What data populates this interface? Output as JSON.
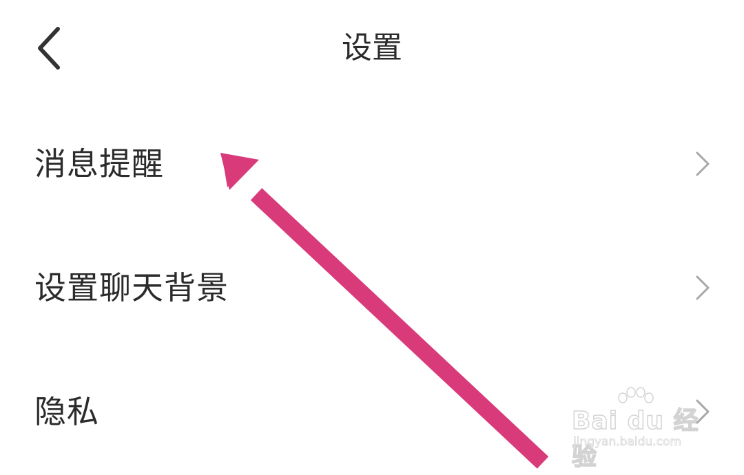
{
  "header": {
    "title": "设置",
    "back_icon": "chevron-left-icon"
  },
  "settings": {
    "items": [
      {
        "label": "消息提醒",
        "icon": "chevron-right-icon"
      },
      {
        "label": "设置聊天背景",
        "icon": "chevron-right-icon"
      },
      {
        "label": "隐私",
        "icon": "chevron-right-icon"
      }
    ]
  },
  "annotation": {
    "arrow_color": "#d93a7a"
  },
  "watermark": {
    "brand": "Bai du 经验",
    "sub": "jingyan.baidu.com"
  },
  "colors": {
    "text": "#2b2b2b",
    "chevron": "#a8a8a8",
    "background": "#ffffff"
  }
}
